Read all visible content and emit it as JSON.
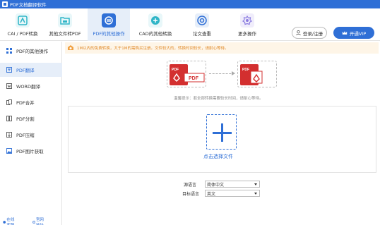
{
  "window": {
    "title": "PDF文档翻译软件"
  },
  "toolbar": {
    "tools": [
      {
        "label": "CAI / PDF转换",
        "icon": "cad-convert-icon",
        "color": "#2fb5c7"
      },
      {
        "label": "其他文件转PDF",
        "icon": "file-to-pdf-icon",
        "color": "#2fb5c7"
      },
      {
        "label": "PDF的其他操作",
        "icon": "pdf-ops-icon",
        "color": "#2f6fd6"
      },
      {
        "label": "CAD的其他转换",
        "icon": "cad-ops-icon",
        "color": "#2fb5c7"
      },
      {
        "label": "论文查重",
        "icon": "paper-check-icon",
        "color": "#2f6fd6"
      },
      {
        "label": "更多操作",
        "icon": "more-ops-icon",
        "color": "#8a7be0"
      }
    ],
    "login_label": "登录/注册",
    "vip_label": "开通VIP"
  },
  "sidebar": {
    "items": [
      {
        "label": "PDF的其他操作",
        "icon": "grid-icon"
      },
      {
        "label": "PDF翻译",
        "icon": "translate-icon"
      },
      {
        "label": "WORD翻译",
        "icon": "word-icon"
      },
      {
        "label": "PDF合并",
        "icon": "merge-icon"
      },
      {
        "label": "PDF分割",
        "icon": "split-icon"
      },
      {
        "label": "PDF压缩",
        "icon": "compress-icon"
      },
      {
        "label": "PDF图片获取",
        "icon": "image-icon"
      }
    ],
    "footer_online": "在线客服",
    "footer_site": "官网地址"
  },
  "main": {
    "notice": "1M以内的免费转换，大于1M的需购买注册。文件较大的，转换时间较长，请耐心等待。",
    "pdf_badge": "PDF",
    "tip": "温馨提示：若全部转换需要较长时间，请耐心等待。",
    "select_file": "点击选择文件",
    "source_lang_label": "源语言",
    "source_lang_value": "简体中文",
    "target_lang_label": "目标语言",
    "target_lang_value": "英文"
  },
  "colors": {
    "accent": "#2f6fd6",
    "pdf_red": "#d32f2f",
    "notice_text": "#e08a2a"
  }
}
